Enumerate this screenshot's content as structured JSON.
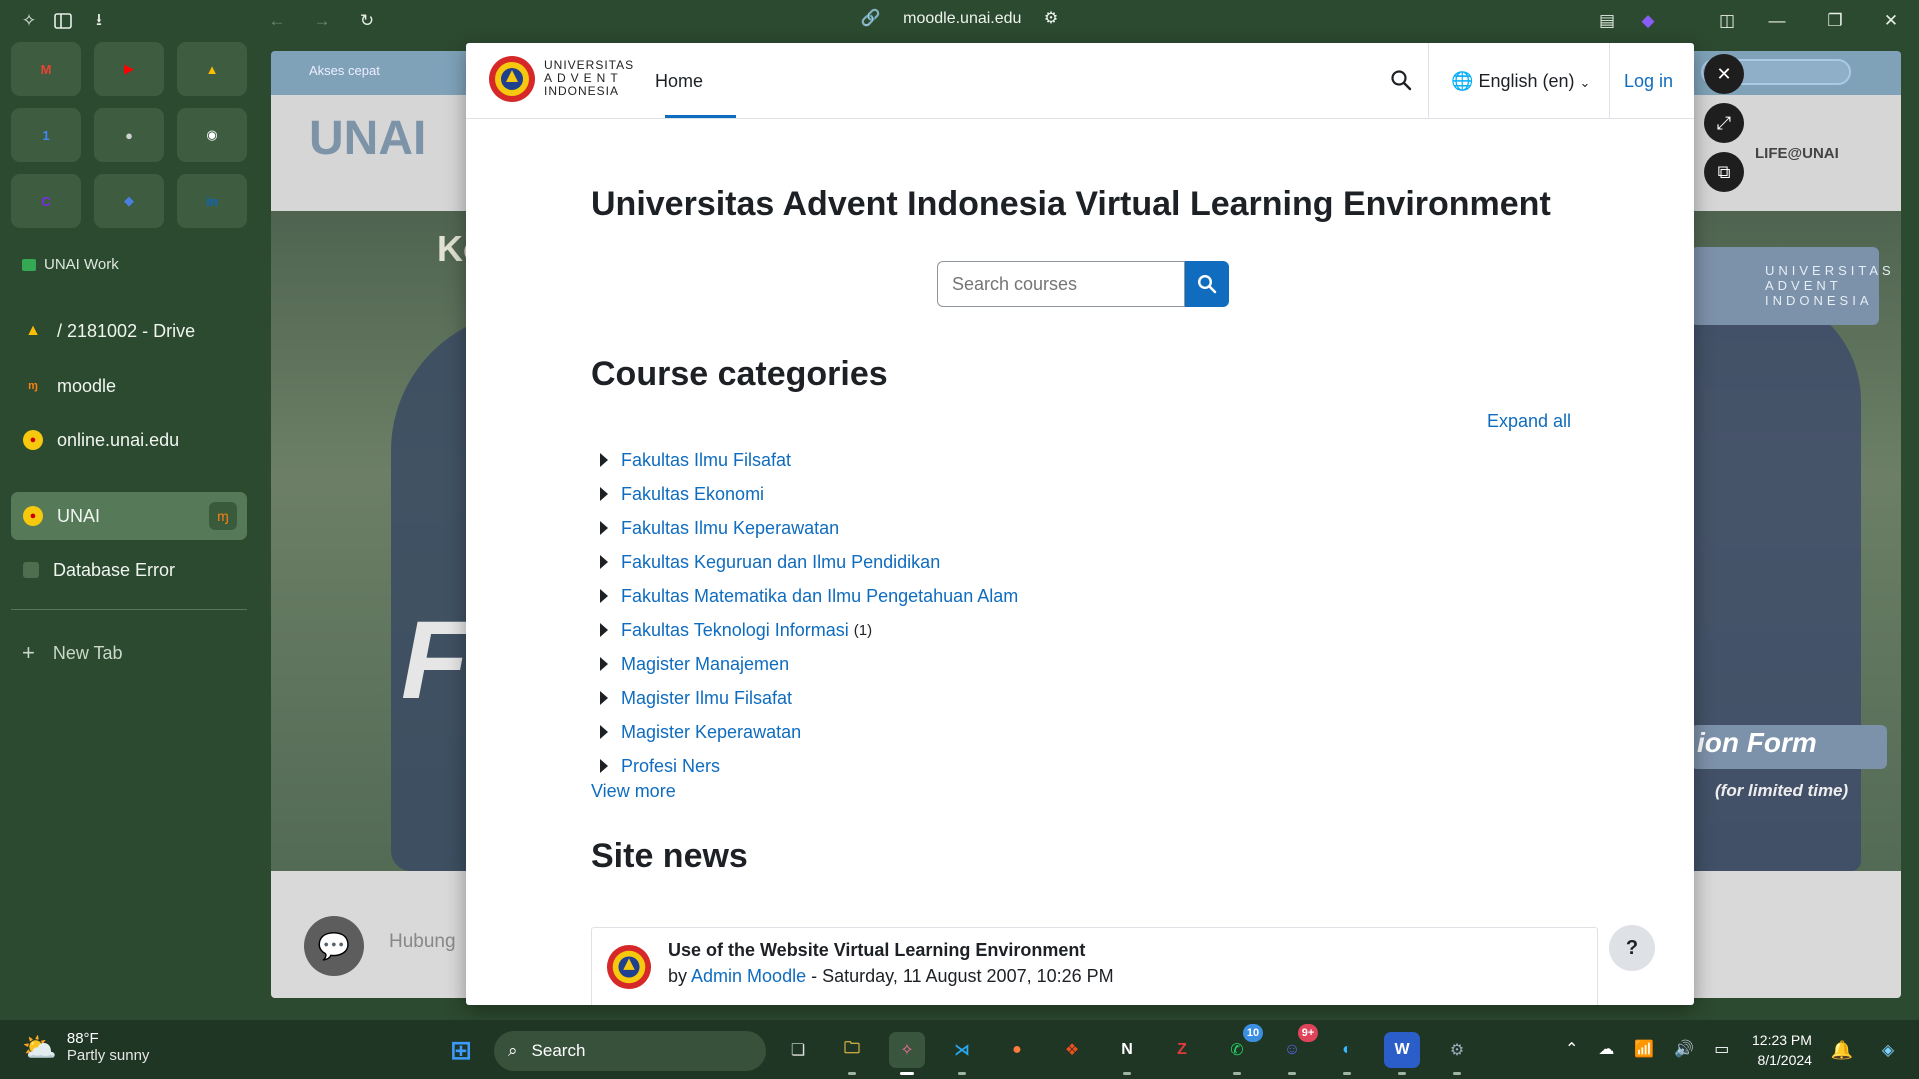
{
  "browser": {
    "url": "moodle.unai.edu"
  },
  "sidebar": {
    "pinned": [
      {
        "name": "gmail-icon",
        "color": "#ea4335",
        "glyph": "M"
      },
      {
        "name": "youtube-icon",
        "color": "#ff0000",
        "glyph": "▶"
      },
      {
        "name": "google-drive-icon",
        "color": "#fbbc04",
        "glyph": "▲"
      },
      {
        "name": "google-calendar-icon",
        "color": "#4285f4",
        "glyph": "1"
      },
      {
        "name": "profile-icon",
        "color": "#d0d0d0",
        "glyph": "●"
      },
      {
        "name": "github-icon",
        "color": "#ffffff",
        "glyph": "◉"
      },
      {
        "name": "canva-icon",
        "color": "#7d2ae8",
        "glyph": "C"
      },
      {
        "name": "diamond-icon",
        "color": "#4a7fe0",
        "glyph": "◆"
      },
      {
        "name": "linkedin-icon",
        "color": "#0a66c2",
        "glyph": "in"
      }
    ],
    "space_label": "UNAI Work",
    "tabs": [
      {
        "label": "/ 2181002 - Drive",
        "icon": "google-drive-icon"
      },
      {
        "label": "moodle",
        "icon": "moodle-icon"
      },
      {
        "label": "online.unai.edu",
        "icon": "unai-icon"
      },
      {
        "label": "UNAI",
        "icon": "unai-icon"
      },
      {
        "label": "Database Error",
        "icon": "blank-page-icon"
      }
    ],
    "new_tab_label": "New Tab"
  },
  "background_site": {
    "quick_access": "Akses cepat",
    "logo_text": "UNAI",
    "life_menu": "LIFE@UNAI",
    "badge_text": "UNIVERSITAS ADVENT INDONESIA",
    "form_text": "ion Form",
    "limited_text": "(for limited time)",
    "contact_text": "Hubung",
    "hero_partial": "Ko M",
    "hero_big": "F F"
  },
  "moodle": {
    "logo_text_1": "UNIVERSITAS",
    "logo_text_2": "ADVENT",
    "logo_text_3": "INDONESIA",
    "nav_home": "Home",
    "language": "English (en)",
    "login": "Log in",
    "site_title": "Universitas Advent Indonesia Virtual Learning Environment",
    "search_placeholder": "Search courses",
    "categories_heading": "Course categories",
    "expand_all": "Expand all",
    "categories": [
      {
        "name": "Fakultas Ilmu Filsafat",
        "count": ""
      },
      {
        "name": "Fakultas Ekonomi",
        "count": ""
      },
      {
        "name": "Fakultas Ilmu Keperawatan",
        "count": ""
      },
      {
        "name": "Fakultas Keguruan dan Ilmu Pendidikan",
        "count": ""
      },
      {
        "name": "Fakultas Matematika dan Ilmu Pengetahuan Alam",
        "count": ""
      },
      {
        "name": "Fakultas Teknologi Informasi",
        "count": "(1)"
      },
      {
        "name": "Magister Manajemen",
        "count": ""
      },
      {
        "name": "Magister Ilmu Filsafat",
        "count": ""
      },
      {
        "name": "Magister Keperawatan",
        "count": ""
      },
      {
        "name": "Profesi Ners",
        "count": ""
      }
    ],
    "view_more": "View more",
    "news_heading": "Site news",
    "post": {
      "title": "Use of the Website Virtual Learning Environment",
      "by_prefix": "by",
      "author": "Admin Moodle",
      "date": "- Saturday, 11 August 2007, 10:26 PM"
    },
    "help": "?"
  },
  "taskbar": {
    "temperature": "88°F",
    "condition": "Partly sunny",
    "search_label": "Search",
    "whatsapp_badge": "10",
    "discord_badge": "9+",
    "time": "12:23 PM",
    "date": "8/1/2024"
  }
}
